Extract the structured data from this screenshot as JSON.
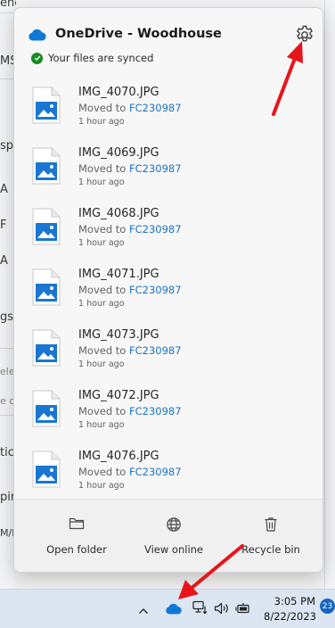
{
  "header": {
    "title": "OneDrive - Woodhouse",
    "status_text": "Your files are synced"
  },
  "files": [
    {
      "name": "IMG_4070.JPG",
      "moved_prefix": "Moved to ",
      "folder": "FC230987",
      "time": "1 hour ago"
    },
    {
      "name": "IMG_4069.JPG",
      "moved_prefix": "Moved to ",
      "folder": "FC230987",
      "time": "1 hour ago"
    },
    {
      "name": "IMG_4068.JPG",
      "moved_prefix": "Moved to ",
      "folder": "FC230987",
      "time": "1 hour ago"
    },
    {
      "name": "IMG_4071.JPG",
      "moved_prefix": "Moved to ",
      "folder": "FC230987",
      "time": "1 hour ago"
    },
    {
      "name": "IMG_4073.JPG",
      "moved_prefix": "Moved to ",
      "folder": "FC230987",
      "time": "1 hour ago"
    },
    {
      "name": "IMG_4072.JPG",
      "moved_prefix": "Moved to ",
      "folder": "FC230987",
      "time": "1 hour ago"
    },
    {
      "name": "IMG_4076.JPG",
      "moved_prefix": "Moved to ",
      "folder": "FC230987",
      "time": "1 hour ago"
    }
  ],
  "footer": {
    "open_folder": "Open folder",
    "view_online": "View online",
    "recycle_bin": "Recycle bin"
  },
  "taskbar": {
    "time": "3:05 PM",
    "date": "8/22/2023",
    "notification_count": "23"
  },
  "background_snippets": [
    "eneral",
    "MS",
    "sp",
    "A",
    "F",
    "A",
    "gs",
    "ele",
    "e c",
    "tic",
    "pir",
    "M/I"
  ],
  "icons": {
    "onedrive": "cloud-icon",
    "settings": "gear-icon",
    "synced": "check-circle-icon",
    "file": "image-file-icon",
    "open_folder": "folder-icon",
    "view_online": "globe-icon",
    "recycle_bin": "trash-icon"
  },
  "colors": {
    "accent": "#1a73c9",
    "onedrive_blue": "#0f78d4",
    "synced_green": "#178c24",
    "annotation_red": "#e8141b"
  }
}
